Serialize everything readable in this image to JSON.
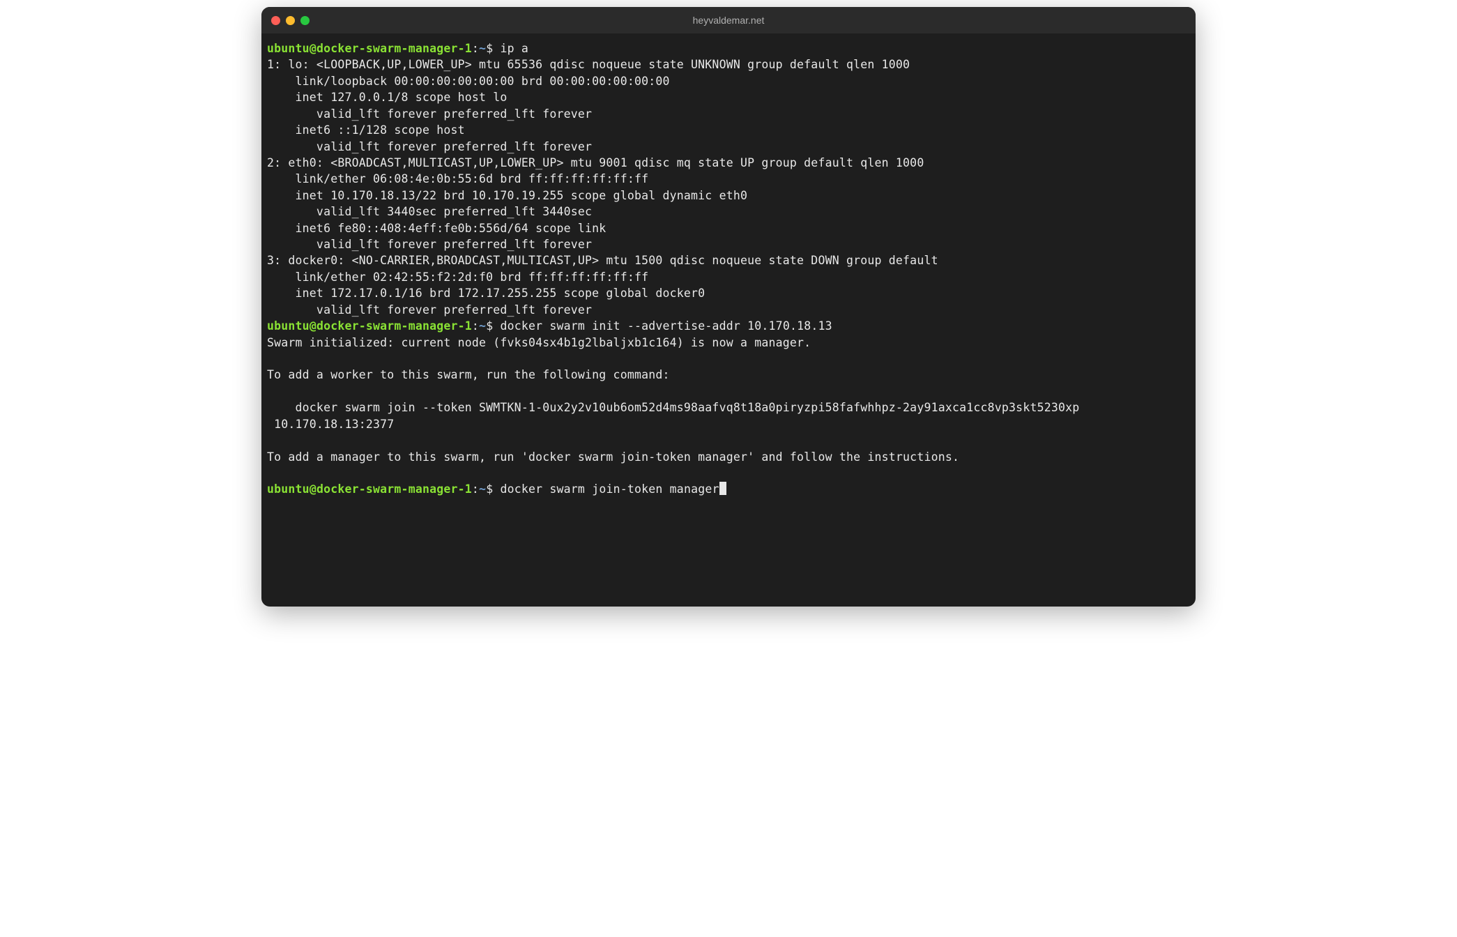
{
  "window": {
    "title": "heyvaldemar.net"
  },
  "prompt": {
    "user": "ubuntu",
    "at": "@",
    "host": "docker-swarm-manager-1",
    "colon": ":",
    "path": "~",
    "symbol": "$"
  },
  "lines": {
    "cmd1": " ip a",
    "o1": "1: lo: <LOOPBACK,UP,LOWER_UP> mtu 65536 qdisc noqueue state UNKNOWN group default qlen 1000",
    "o2": "    link/loopback 00:00:00:00:00:00 brd 00:00:00:00:00:00",
    "o3": "    inet 127.0.0.1/8 scope host lo",
    "o4": "       valid_lft forever preferred_lft forever",
    "o5": "    inet6 ::1/128 scope host ",
    "o6": "       valid_lft forever preferred_lft forever",
    "o7": "2: eth0: <BROADCAST,MULTICAST,UP,LOWER_UP> mtu 9001 qdisc mq state UP group default qlen 1000",
    "o8": "    link/ether 06:08:4e:0b:55:6d brd ff:ff:ff:ff:ff:ff",
    "o9": "    inet 10.170.18.13/22 brd 10.170.19.255 scope global dynamic eth0",
    "o10": "       valid_lft 3440sec preferred_lft 3440sec",
    "o11": "    inet6 fe80::408:4eff:fe0b:556d/64 scope link ",
    "o12": "       valid_lft forever preferred_lft forever",
    "o13": "3: docker0: <NO-CARRIER,BROADCAST,MULTICAST,UP> mtu 1500 qdisc noqueue state DOWN group default ",
    "o14": "    link/ether 02:42:55:f2:2d:f0 brd ff:ff:ff:ff:ff:ff",
    "o15": "    inet 172.17.0.1/16 brd 172.17.255.255 scope global docker0",
    "o16": "       valid_lft forever preferred_lft forever",
    "cmd2": " docker swarm init --advertise-addr 10.170.18.13",
    "o17": "Swarm initialized: current node (fvks04sx4b1g2lbaljxb1c164) is now a manager.",
    "o18": "",
    "o19": "To add a worker to this swarm, run the following command:",
    "o20": "",
    "o21": "    docker swarm join --token SWMTKN-1-0ux2y2v10ub6om52d4ms98aafvq8t18a0piryzpi58fafwhhpz-2ay91axca1cc8vp3skt5230xp",
    "o22": " 10.170.18.13:2377",
    "o23": "",
    "o24": "To add a manager to this swarm, run 'docker swarm join-token manager' and follow the instructions.",
    "o25": "",
    "cmd3": " docker swarm join-token manager"
  }
}
